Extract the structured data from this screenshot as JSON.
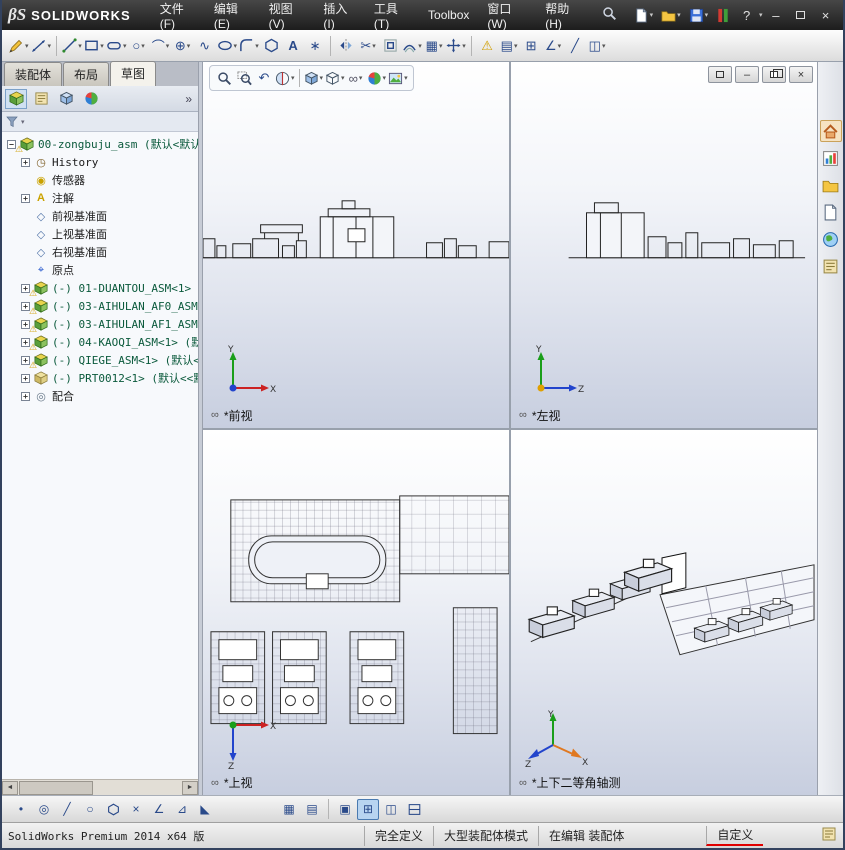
{
  "icons": {
    "caret": "▾",
    "warning": "⚠",
    "plus": "+",
    "minus": "−",
    "history": "◷",
    "sensor": "◉",
    "annotation": "A",
    "plane": "◇",
    "origin": "⌖",
    "mates": "◎",
    "glasses": "∞",
    "chevrons": "»",
    "help": "?",
    "min": "–",
    "close": "×",
    "dot": "•",
    "slash": "╱",
    "circle": "○",
    "arc": "⌒",
    "spline": "∿",
    "oplus": "⊕",
    "point": "∗",
    "text": "A",
    "grid": "▦",
    "grid2": "▤",
    "angle": "∠",
    "rtriangle": "⊿",
    "ltriangle": "◣",
    "scissors": "✂",
    "fourpane": "⊞",
    "twopane": "◫",
    "onepane": "▣",
    "left_arrow": "◄",
    "right_arrow": "►",
    "undo": "↶"
  },
  "titlebar": {
    "logo_glyph": "βS",
    "brand": "SOLIDWORKS",
    "menus": [
      "文件(F)",
      "编辑(E)",
      "视图(V)",
      "插入(I)",
      "工具(T)",
      "Toolbox",
      "窗口(W)",
      "帮助(H)"
    ]
  },
  "left_panel": {
    "tabs": [
      {
        "label": "装配体"
      },
      {
        "label": "布局"
      },
      {
        "label": "草图"
      }
    ],
    "active_tab": "草图",
    "tree": [
      {
        "label": "00-zongbuju_asm (默认<默认",
        "icon": "assembly",
        "warning": true
      },
      {
        "label": "History",
        "icon": "history"
      },
      {
        "label": "传感器",
        "icon": "sensors"
      },
      {
        "label": "注解",
        "icon": "annotations"
      },
      {
        "label": "前视基准面",
        "icon": "plane"
      },
      {
        "label": "上视基准面",
        "icon": "plane"
      },
      {
        "label": "右视基准面",
        "icon": "plane"
      },
      {
        "label": "原点",
        "icon": "origin"
      },
      {
        "label": "(-) 01-DUANTOU_ASM<1>",
        "icon": "assembly",
        "warning": true
      },
      {
        "label": "(-) 03-AIHULAN_AF0_ASM<",
        "icon": "assembly",
        "warning": true
      },
      {
        "label": "(-) 03-AIHULAN_AF1_ASM<",
        "icon": "assembly",
        "warning": true
      },
      {
        "label": "(-) 04-KAOQI_ASM<1> (默",
        "icon": "assembly",
        "warning": true
      },
      {
        "label": "(-) QIEGE_ASM<1> (默认<",
        "icon": "assembly",
        "warning": true
      },
      {
        "label": "(-) PRT0012<1> (默认<<默认",
        "icon": "part"
      },
      {
        "label": "配合",
        "icon": "mates"
      }
    ]
  },
  "main_toolbar_icons": [
    "sketch",
    "smart-dimension",
    "line",
    "rectangle",
    "slot",
    "circle",
    "arc",
    "perimeter-circle",
    "spline",
    "ellipse",
    "fillet",
    "polygon",
    "text",
    "point",
    "mirror-entities",
    "trim-entities",
    "convert-entities",
    "offset-entities",
    "linear-sketch-pattern",
    "move-entities",
    "repair-sketch",
    "display-grid",
    "rapid-sketch"
  ],
  "headsup_icons": [
    "zoom-fit",
    "zoom-area",
    "previous-view",
    "section-view",
    "view-orientation",
    "display-style",
    "hide-show-items",
    "edit-appearance",
    "apply-scene",
    "view-settings"
  ],
  "taskpane_icons": [
    "resources",
    "design-library",
    "file-explorer",
    "view-palette",
    "appearances",
    "custom-properties"
  ],
  "bottom_toolbar_icons": [
    "point",
    "target",
    "line",
    "circle",
    "polygon",
    "delete",
    "angle",
    "triangle",
    "corner",
    "grid",
    "grid-alt",
    "single-view",
    "four-view",
    "two-view-horizontal",
    "two-view-vertical"
  ],
  "viewports": {
    "front": {
      "label": "*前视",
      "axis_up": "Y",
      "axis_right": "X"
    },
    "left": {
      "label": "*左视",
      "axis_up": "Y",
      "axis_right": "Z"
    },
    "top": {
      "label": "*上视",
      "axis_right": "X",
      "axis_down": "Z"
    },
    "iso": {
      "label": "*上下二等角轴测",
      "axis_up": "Y",
      "axis_right": "X",
      "axis_left": "Z"
    }
  },
  "statusbar": {
    "app_info": "SolidWorks Premium 2014 x64 版",
    "define_state": "完全定义",
    "assembly_mode": "大型装配体模式",
    "editing_state": "在编辑 装配体",
    "custom": "自定义"
  }
}
